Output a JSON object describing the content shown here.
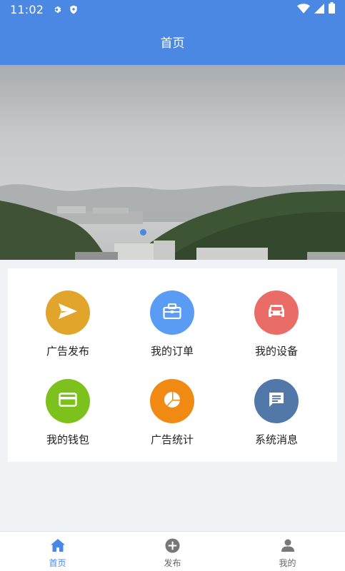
{
  "status_bar": {
    "time": "11:02"
  },
  "app_bar": {
    "title": "首页"
  },
  "menu": [
    {
      "label": "广告发布",
      "icon": "send-icon",
      "color": "#e0a52a"
    },
    {
      "label": "我的订单",
      "icon": "briefcase-icon",
      "color": "#5a9cf4"
    },
    {
      "label": "我的设备",
      "icon": "car-icon",
      "color": "#e96d66"
    },
    {
      "label": "我的钱包",
      "icon": "wallet-card-icon",
      "color": "#7cc11c"
    },
    {
      "label": "广告统计",
      "icon": "pie-chart-icon",
      "color": "#f18a12"
    },
    {
      "label": "系统消息",
      "icon": "message-icon",
      "color": "#5278a9"
    }
  ],
  "bottom_nav": [
    {
      "label": "首页",
      "icon": "home-icon",
      "active": true
    },
    {
      "label": "发布",
      "icon": "add-circle-icon",
      "active": false
    },
    {
      "label": "我的",
      "icon": "person-icon",
      "active": false
    }
  ],
  "colors": {
    "primary": "#4a88e3",
    "active_nav": "#4a88e3",
    "inactive_nav": "#666666"
  }
}
